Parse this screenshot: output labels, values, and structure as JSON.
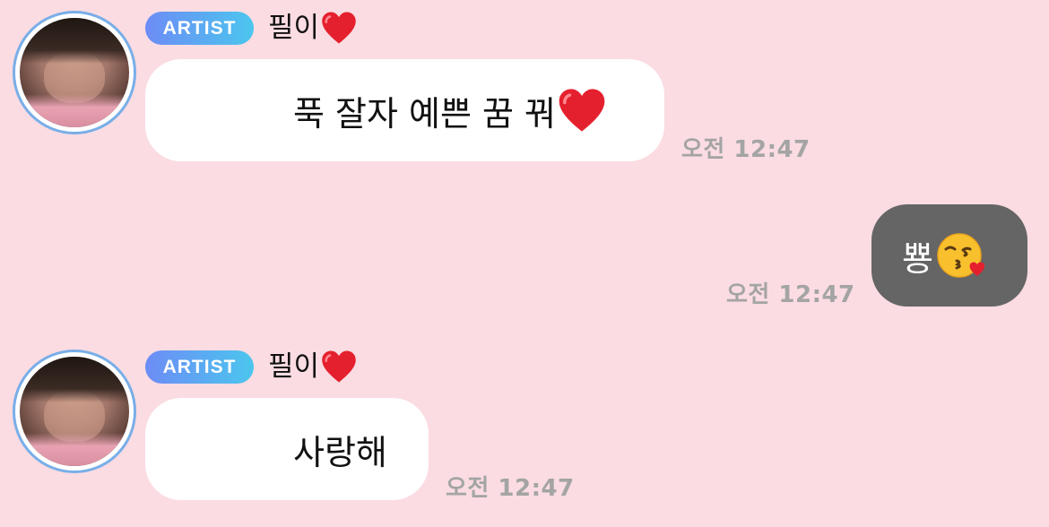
{
  "colors": {
    "background": "#fadce2",
    "incoming_bubble": "#ffffff",
    "outgoing_bubble": "#656565",
    "timestamp": "#a4a4a4",
    "badge_gradient_start": "#6d8cf6",
    "badge_gradient_end": "#4bc6ee",
    "avatar_ring": "#79aee8",
    "heart": "#e5202e"
  },
  "messages": [
    {
      "direction": "incoming",
      "badge": "ARTIST",
      "sender": "필이",
      "sender_icon": "red-heart-icon",
      "text": "푹 잘자 예쁜 꿈 꿔",
      "text_icon": "red-heart-icon",
      "time": "오전 12:47"
    },
    {
      "direction": "outgoing",
      "text": "뿅",
      "text_icon": "face-blowing-kiss-icon",
      "time": "오전 12:47"
    },
    {
      "direction": "incoming",
      "badge": "ARTIST",
      "sender": "필이",
      "sender_icon": "red-heart-icon",
      "text": "사랑해",
      "time": "오전 12:47"
    }
  ]
}
